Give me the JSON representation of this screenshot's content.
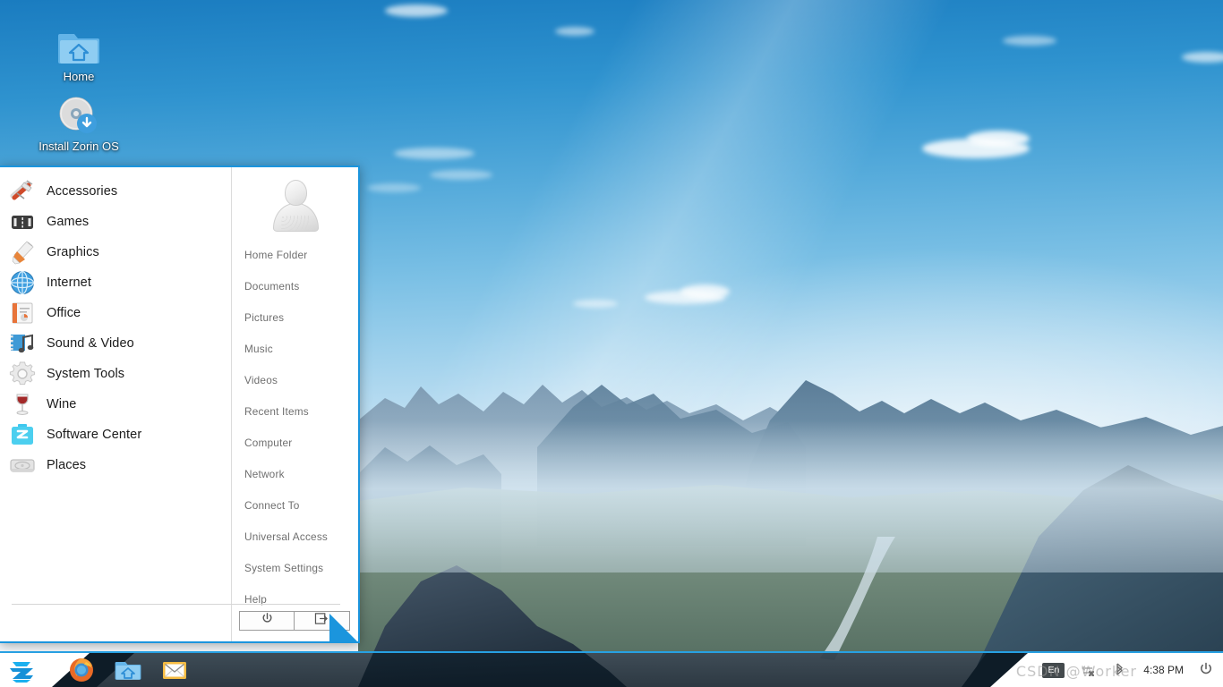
{
  "desktop": {
    "icons": [
      {
        "name": "Home",
        "icon": "home-folder-icon"
      },
      {
        "name": "Install Zorin OS",
        "icon": "install-disc-icon"
      }
    ]
  },
  "start_menu": {
    "categories": [
      {
        "label": "Accessories",
        "icon": "swiss-army-knife-icon"
      },
      {
        "label": "Games",
        "icon": "gamepad-icon"
      },
      {
        "label": "Graphics",
        "icon": "paint-brush-icon"
      },
      {
        "label": "Internet",
        "icon": "globe-network-icon"
      },
      {
        "label": "Office",
        "icon": "document-icon"
      },
      {
        "label": "Sound & Video",
        "icon": "film-music-icon"
      },
      {
        "label": "System Tools",
        "icon": "gear-icon"
      },
      {
        "label": "Wine",
        "icon": "wine-glass-icon"
      },
      {
        "label": "Software Center",
        "icon": "zorin-software-icon"
      },
      {
        "label": "Places",
        "icon": "hard-drive-icon"
      }
    ],
    "user": {
      "avatar": "user-avatar-icon"
    },
    "places": [
      {
        "label": "Home Folder"
      },
      {
        "label": "Documents"
      },
      {
        "label": "Pictures"
      },
      {
        "label": "Music"
      },
      {
        "label": "Videos"
      },
      {
        "label": "Recent Items"
      },
      {
        "label": "Computer"
      },
      {
        "label": "Network"
      },
      {
        "label": "Connect To"
      },
      {
        "label": "Universal Access"
      },
      {
        "label": "System Settings"
      },
      {
        "label": "Help"
      }
    ],
    "footer": {
      "shutdown_icon": "power-icon",
      "logout_icon": "logout-icon"
    },
    "accent_border": "#1b95dd"
  },
  "taskbar": {
    "start_button": {
      "label": "",
      "icon": "zorin-logo-icon"
    },
    "launchers": [
      {
        "name": "Firefox",
        "icon": "firefox-icon"
      },
      {
        "name": "Files",
        "icon": "file-manager-icon"
      },
      {
        "name": "Mail",
        "icon": "mail-icon"
      }
    ],
    "tray": {
      "keyboard_layout": "En",
      "network_icon": "network-disconnected-icon",
      "bluetooth_icon": "bluetooth-icon",
      "clock": "4:38 PM",
      "power_icon": "power-tray-icon"
    },
    "accent": "#27a0e2"
  },
  "watermark": {
    "text": "CSDN @Worker"
  }
}
